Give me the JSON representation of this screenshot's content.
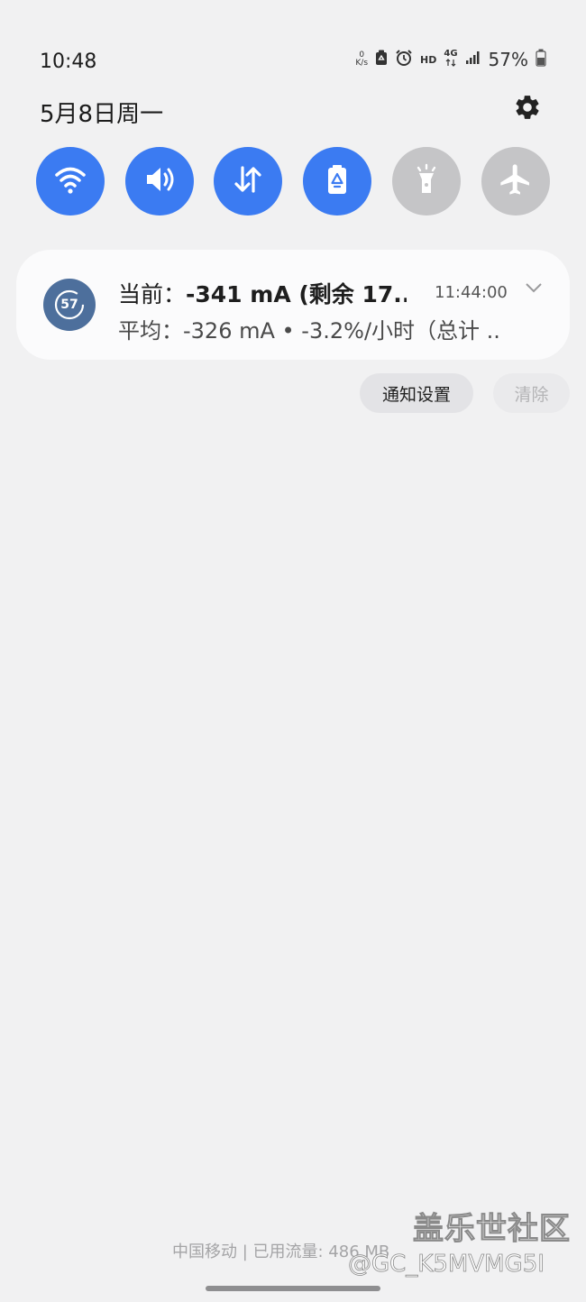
{
  "status_bar": {
    "time": "10:48",
    "net_speed_value": "0",
    "net_speed_unit": "K/s",
    "hd_label": "HD",
    "network_type": "4G",
    "battery_percent": "57%"
  },
  "header": {
    "date": "5月8日周一",
    "settings_icon": "gear-icon"
  },
  "quick_settings": [
    {
      "name": "wifi",
      "icon": "wifi-icon",
      "state": "on"
    },
    {
      "name": "sound",
      "icon": "speaker-icon",
      "state": "on"
    },
    {
      "name": "mobile-data",
      "icon": "data-arrows-icon",
      "state": "on"
    },
    {
      "name": "power-saving",
      "icon": "battery-saver-icon",
      "state": "on"
    },
    {
      "name": "flashlight",
      "icon": "flashlight-icon",
      "state": "off"
    },
    {
      "name": "airplane-mode",
      "icon": "airplane-icon",
      "state": "off"
    }
  ],
  "notification": {
    "app_icon_text": "57",
    "title_prefix": "当前：",
    "title_value": "-341 mA (剩余 17...",
    "time": "11:44:00",
    "body": "平均：-326 mA • -3.2%/小时（总计 .."
  },
  "actions": {
    "notification_settings": "通知设置",
    "clear": "清除"
  },
  "footer": {
    "carrier_info": "中国移动 | 已用流量: 486 MB"
  },
  "watermark": {
    "brand": "盖乐世社区",
    "user": "@GC_K5MVMG5I"
  },
  "colors": {
    "accent": "#3b7bf2",
    "inactive_tile": "#c5c5c7",
    "background": "#f1f1f2",
    "card": "#fbfbfc"
  }
}
